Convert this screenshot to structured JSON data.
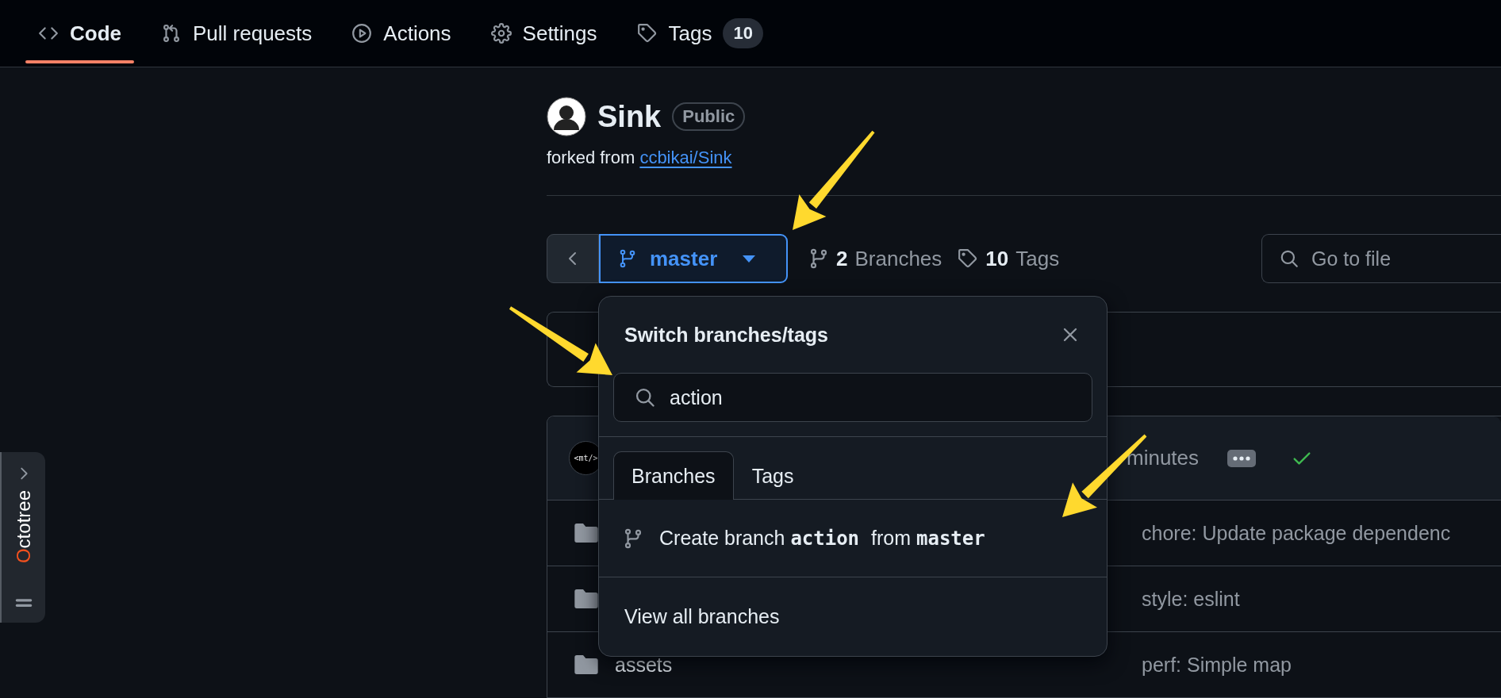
{
  "nav": {
    "tabs": [
      {
        "label": "Code",
        "selected": true
      },
      {
        "label": "Pull requests",
        "selected": false
      },
      {
        "label": "Actions",
        "selected": false
      },
      {
        "label": "Settings",
        "selected": false
      },
      {
        "label": "Tags",
        "selected": false,
        "count": "10"
      }
    ]
  },
  "repo": {
    "name": "Sink",
    "visibility": "Public",
    "fork_prefix": "forked from",
    "fork_source": "ccbikai/Sink"
  },
  "branch_bar": {
    "branch": "master",
    "branches_count": "2",
    "branches_label": "Branches",
    "tags_count": "10",
    "tags_label": "Tags",
    "file_search_placeholder": "Go to file"
  },
  "commit": {
    "avatar_text": "<mt/>",
    "time": "minutes"
  },
  "files": [
    {
      "message": "chore: Update package dependenc"
    },
    {
      "message": "style: eslint"
    },
    {
      "name": "assets",
      "message": "perf: Simple map"
    }
  ],
  "dropdown": {
    "title": "Switch branches/tags",
    "search_value": "action",
    "tabs": [
      {
        "label": "Branches",
        "selected": true
      },
      {
        "label": "Tags",
        "selected": false
      }
    ],
    "create_row": "Create branch **action** from **master**",
    "view_all": "View all branches"
  },
  "sidebar": {
    "title_accent": "O",
    "title_rest": "ctotree"
  }
}
